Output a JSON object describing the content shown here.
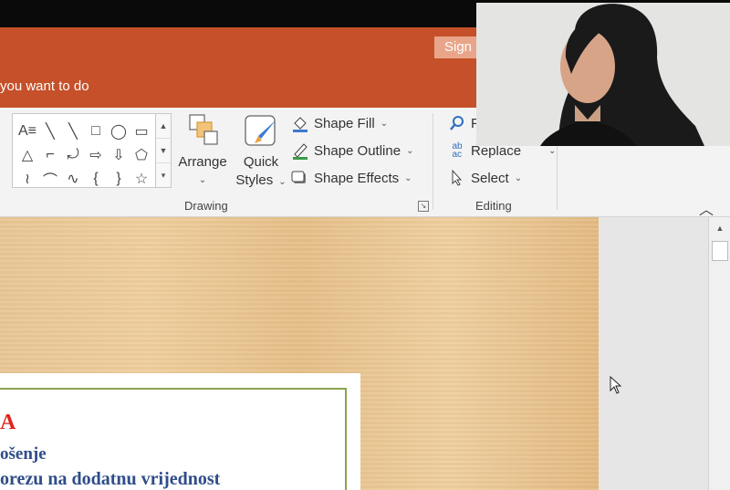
{
  "titlebar": {
    "sign_in_label": "Sign",
    "tell_me": "you want to do"
  },
  "gallery": {
    "shapes": [
      "A≡",
      "╲",
      "╲",
      "□",
      "◯",
      "▭",
      "△",
      "⌐",
      "⤾",
      "⇨",
      "⇩",
      "⬠",
      "≀",
      "⌒",
      "∿",
      "{",
      "}",
      "☆"
    ]
  },
  "drawing": {
    "arrange_label": "Arrange",
    "quick_label1": "Quick",
    "quick_label2": "Styles",
    "shape_fill": "Shape Fill",
    "shape_outline": "Shape Outline",
    "shape_effects": "Shape Effects",
    "group_label": "Drawing"
  },
  "editing": {
    "find_label": "F",
    "replace_label": "Replace",
    "select_label": "Select",
    "group_label": "Editing"
  },
  "slide": {
    "line1": "A",
    "line2": "ošenje",
    "line3": "orezu na dodatnu vrijednost"
  },
  "colors": {
    "ribbon_accent": "#c5502a",
    "slide_title": "#e2231a",
    "slide_text": "#2f4d89",
    "slide_border": "#8aa351"
  }
}
